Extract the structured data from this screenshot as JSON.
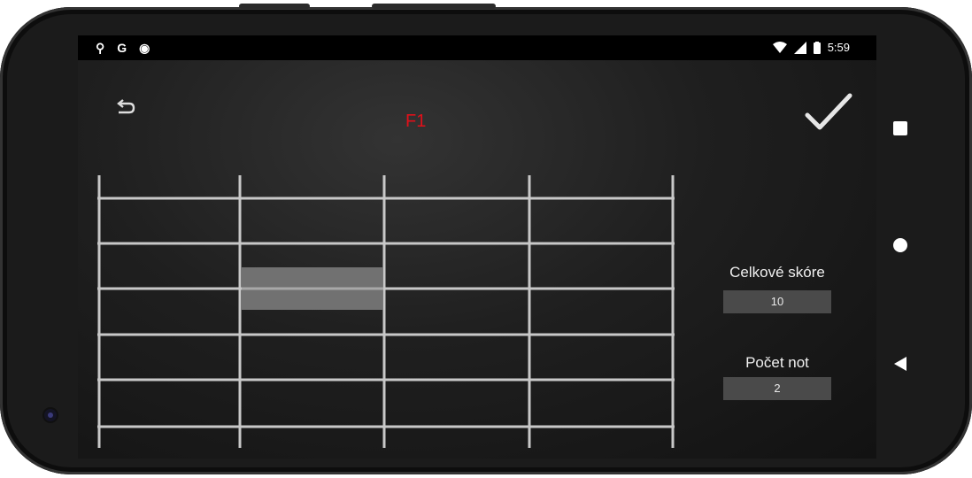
{
  "status_bar": {
    "left_icons": [
      "location-icon",
      "google-icon",
      "record-icon"
    ],
    "left_glyphs": [
      "⚲",
      "G",
      "◉"
    ],
    "time": "5:59"
  },
  "app": {
    "title": "F1",
    "title_color": "#e0101a",
    "back_icon": "undo-icon",
    "confirm_icon": "checkmark-icon",
    "total_score_label": "Celkové skóre",
    "total_score_value": "10",
    "notes_count_label": "Počet not",
    "notes_count_value": "2"
  },
  "nav_bar": {
    "buttons": [
      "recents-square-icon",
      "home-circle-icon",
      "back-triangle-icon"
    ]
  }
}
